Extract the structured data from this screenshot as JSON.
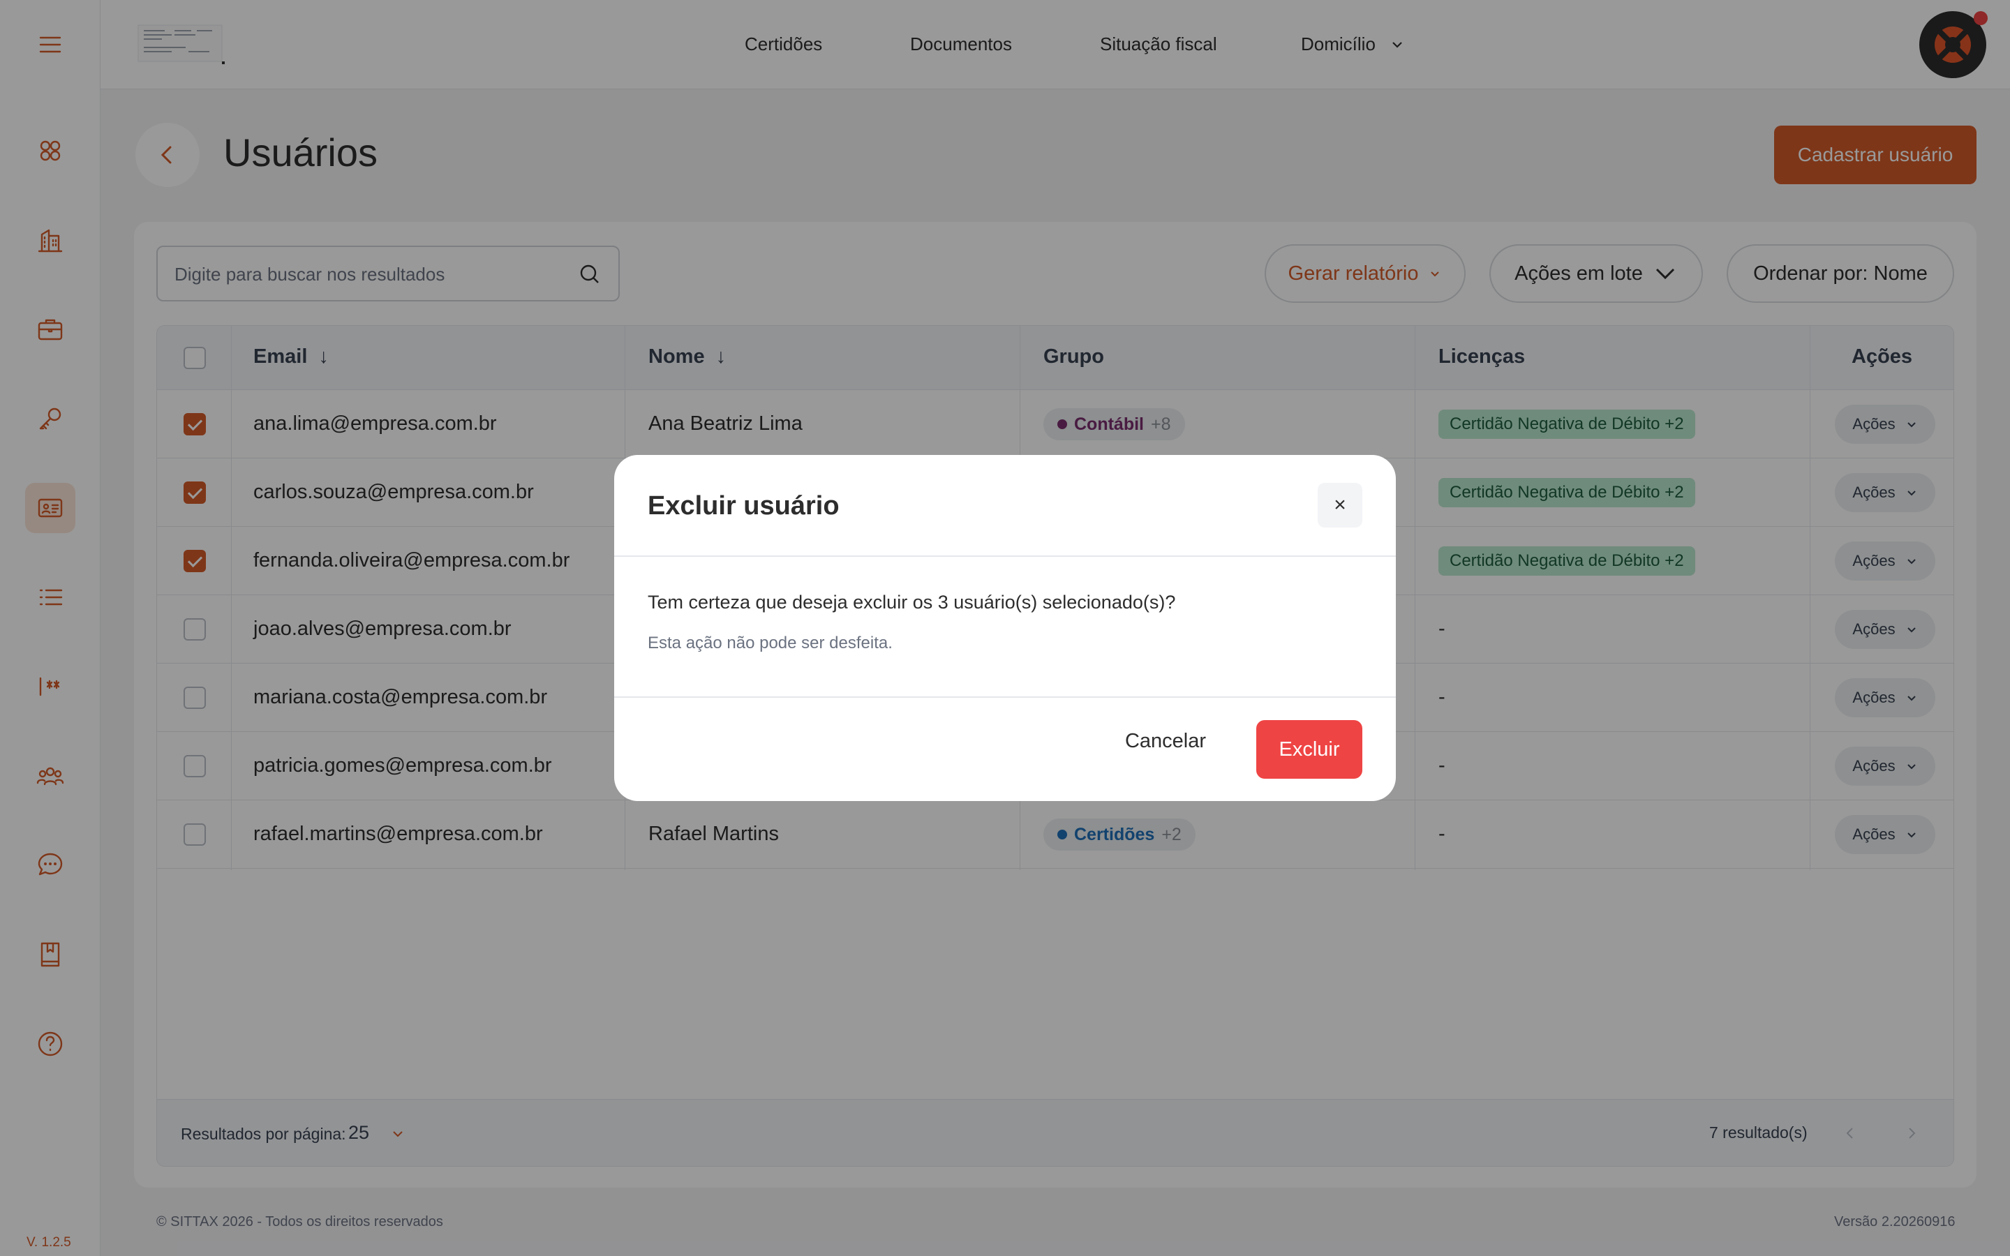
{
  "sidebar": {
    "icons": [
      "menu-icon",
      "dashboard-icon",
      "building-icon",
      "briefcase-icon",
      "key-icon",
      "id-card-icon",
      "list-icon",
      "password-icon",
      "users-icon",
      "chat-icon",
      "book-icon",
      "help-icon"
    ],
    "version": "V. 1.2.5"
  },
  "topnav": {
    "items": [
      "Certidões",
      "Documentos",
      "Situação fiscal",
      "Domicílio"
    ]
  },
  "page": {
    "title": "Usuários",
    "primary_button": "Cadastrar usuário"
  },
  "toolbar": {
    "search_placeholder": "Digite para buscar nos resultados",
    "report_button": "Gerar relatório",
    "bulk_button": "Ações em lote",
    "sort_button": "Ordenar por: Nome"
  },
  "table": {
    "headers": {
      "email": "Email",
      "email_sort": "↓",
      "nome": "Nome",
      "nome_sort": "↓",
      "grupo": "Grupo",
      "licencas": "Licenças",
      "acoes": "Ações"
    },
    "rows": [
      {
        "checked": true,
        "email": "ana.lima@empresa.com.br",
        "nome": "Ana Beatriz Lima",
        "grupo": "Contábil",
        "grupo_plus": "+8",
        "grupo_color": "#7b2d6e",
        "licenca": "Certidão Negativa de Débito +2",
        "acoes": "Ações"
      },
      {
        "checked": true,
        "email": "carlos.souza@empresa.com.br",
        "nome": "",
        "grupo": "",
        "grupo_plus": "",
        "grupo_color": "",
        "licenca": "Certidão Negativa de Débito +2",
        "acoes": "Ações"
      },
      {
        "checked": true,
        "email": "fernanda.oliveira@empresa.com.br",
        "nome": "",
        "grupo": "",
        "grupo_plus": "",
        "grupo_color": "",
        "licenca": "Certidão Negativa de Débito +2",
        "acoes": "Ações"
      },
      {
        "checked": false,
        "email": "joao.alves@empresa.com.br",
        "nome": "",
        "grupo": "",
        "grupo_plus": "",
        "grupo_color": "",
        "licenca": "-",
        "acoes": "Ações"
      },
      {
        "checked": false,
        "email": "mariana.costa@empresa.com.br",
        "nome": "",
        "grupo": "",
        "grupo_plus": "",
        "grupo_color": "",
        "licenca": "-",
        "acoes": "Ações"
      },
      {
        "checked": false,
        "email": "patricia.gomes@empresa.com.br",
        "nome": "",
        "grupo": "",
        "grupo_plus": "",
        "grupo_color": "",
        "licenca": "-",
        "acoes": "Ações"
      },
      {
        "checked": false,
        "email": "rafael.martins@empresa.com.br",
        "nome": "Rafael Martins",
        "grupo": "Certidões",
        "grupo_plus": "+2",
        "grupo_color": "#1e6fb8",
        "licenca": "-",
        "acoes": "Ações"
      }
    ],
    "footer": {
      "per_page_label": "Resultados por página:",
      "per_page_value": "25",
      "results": "7 resultado(s)"
    }
  },
  "footer": {
    "copyright": "© SITTAX 2026 - Todos os direitos reservados",
    "version": "Versão 2.20260916"
  },
  "modal": {
    "title": "Excluir usuário",
    "close": "×",
    "message": "Tem certeza que deseja excluir os 3 usuário(s) selecionado(s)?",
    "submessage": "Esta ação não pode ser desfeita.",
    "cancel": "Cancelar",
    "confirm": "Excluir"
  },
  "colors": {
    "accent": "#d35a28",
    "danger": "#ef4444",
    "license_badge": "#b9e8cf"
  }
}
